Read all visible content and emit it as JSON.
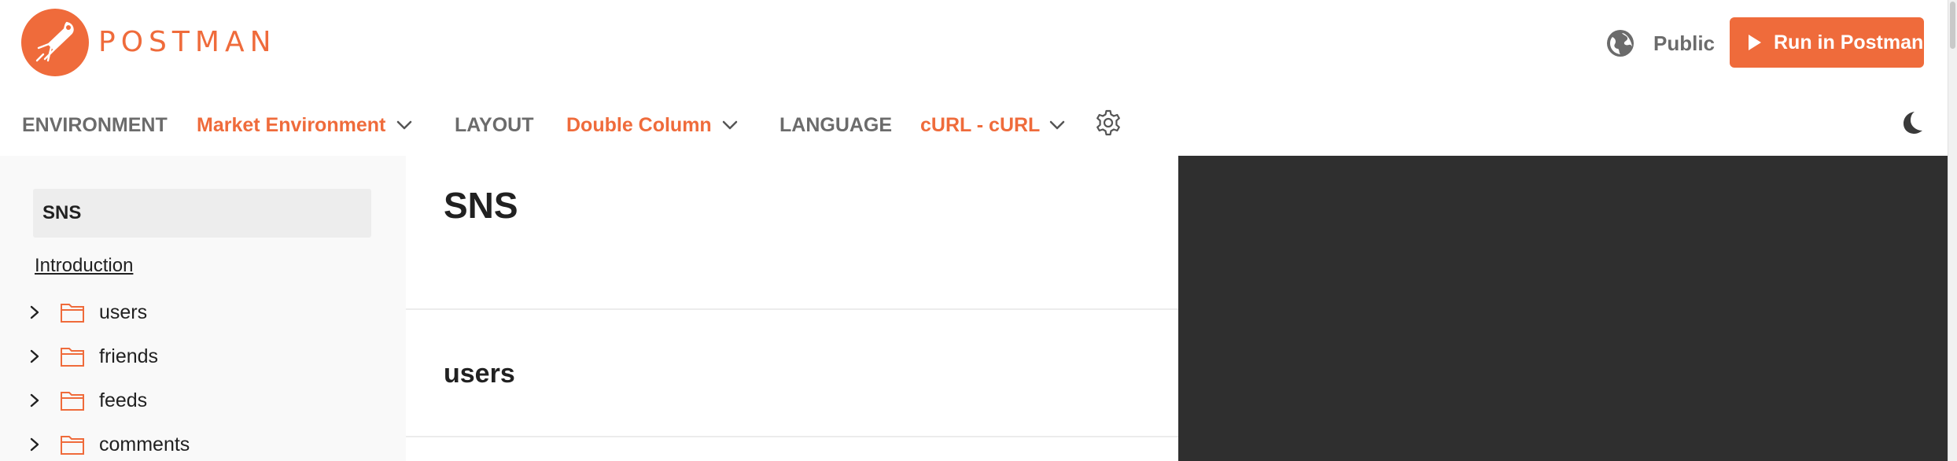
{
  "header": {
    "brand": "POSTMAN",
    "logo_icon": "postman-rocket-logo",
    "visibility_icon": "globe-icon",
    "visibility_label": "Public",
    "run_button_icon": "play-icon",
    "run_button_label": "Run in Postman"
  },
  "toolbar": {
    "environment_label": "ENVIRONMENT",
    "environment_value": "Market Environment",
    "layout_label": "LAYOUT",
    "layout_value": "Double Column",
    "language_label": "LANGUAGE",
    "language_value": "cURL - cURL",
    "settings_icon": "gear-icon",
    "theme_icon": "moon-icon"
  },
  "sidebar": {
    "collection_name": "SNS",
    "intro_link": "Introduction",
    "folders": [
      {
        "label": "users"
      },
      {
        "label": "friends"
      },
      {
        "label": "feeds"
      },
      {
        "label": "comments"
      }
    ]
  },
  "main": {
    "title": "SNS",
    "sections": [
      {
        "title": "users"
      }
    ]
  },
  "colors": {
    "accent": "#EF6B3B",
    "code_pane_bg": "#2F2F2F",
    "sidebar_bg": "#F9F9F9",
    "muted_text": "#6B6B6B"
  }
}
